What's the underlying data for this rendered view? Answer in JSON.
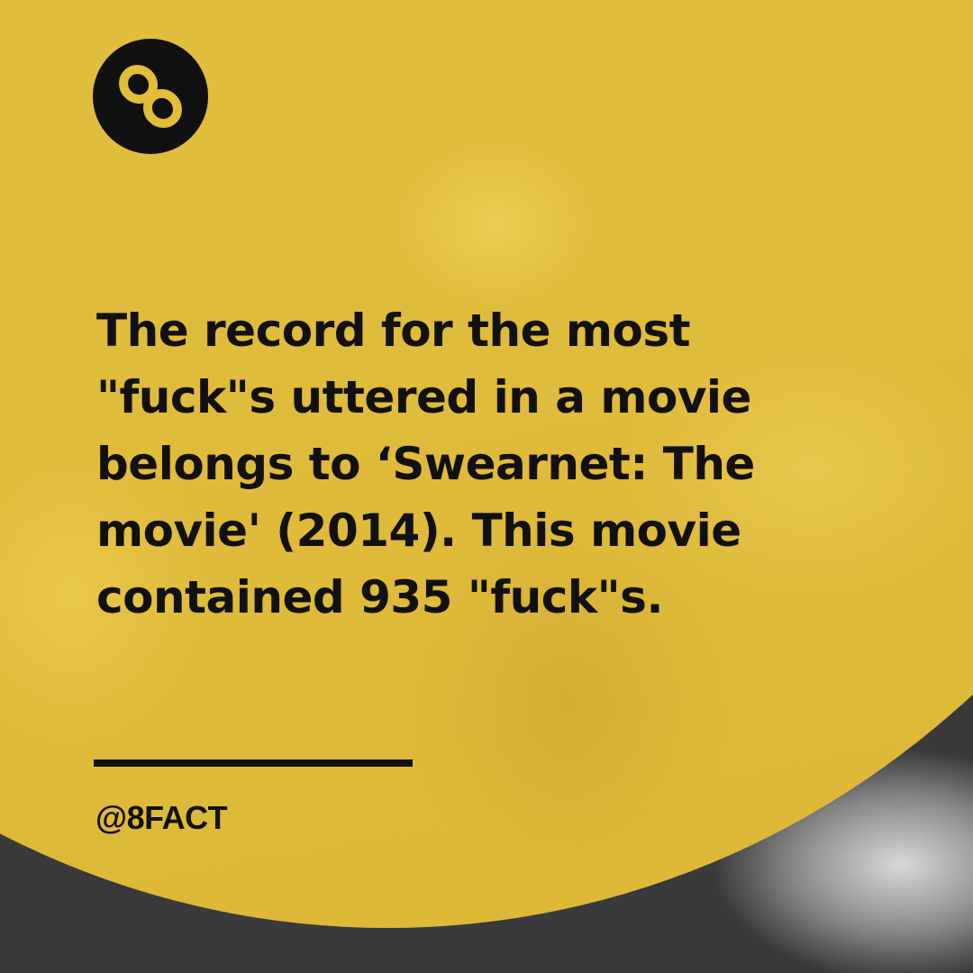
{
  "brand": {
    "logo_icon": "figure-eight-icon",
    "handle": "@8FACT"
  },
  "post": {
    "fact": "The record for the most \"fuck\"s uttered in a movie belongs to ‘Swearnet: The movie' (2014). This movie contained 935 \"fuck\"s."
  },
  "colors": {
    "background_yellow": "#e2bd3a",
    "text": "#111111",
    "logo_circle": "#111111",
    "logo_mark": "#e2bd3a"
  }
}
